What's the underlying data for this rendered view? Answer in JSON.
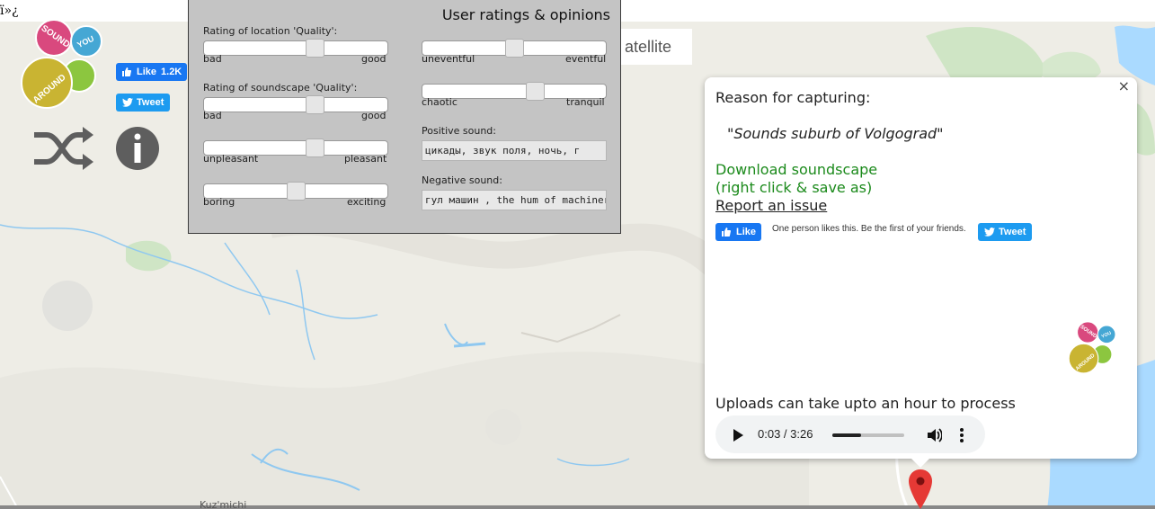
{
  "top_bar": {
    "garbled_text": "ï»¿"
  },
  "logo": {
    "words": [
      "SOUND",
      "YOU",
      "AROUND"
    ]
  },
  "social": {
    "facebook_like_label": "Like",
    "facebook_like_count": "1.2K",
    "tweet_label": "Tweet"
  },
  "map": {
    "satellite_button_label": "atellite",
    "place_label": "Kuz'michi"
  },
  "ratings_panel": {
    "title": "User ratings & opinions",
    "location_quality_label": "Rating of location 'Quality':",
    "soundscape_quality_label": "Rating of soundscape 'Quality':",
    "sliders": [
      {
        "left_label": "bad",
        "right_label": "good",
        "value": 0.62
      },
      {
        "left_label": "bad",
        "right_label": "good",
        "value": 0.62
      },
      {
        "left_label": "unpleasant",
        "right_label": "pleasant",
        "value": 0.62
      },
      {
        "left_label": "boring",
        "right_label": "exciting",
        "value": 0.5
      },
      {
        "left_label": "uneventful",
        "right_label": "eventful",
        "value": 0.5
      },
      {
        "left_label": "chaotic",
        "right_label": "tranquil",
        "value": 0.63
      }
    ],
    "positive_sound_label": "Positive sound:",
    "positive_sound_value": "цикады, звук поля, ночь, г",
    "negative_sound_label": "Negative sound:",
    "negative_sound_value": "гул машин , the hum of machinery"
  },
  "info_window": {
    "close_symbol": "×",
    "reason_label": "Reason for capturing:",
    "reason_quote": "\"Sounds suburb of Volgograd\"",
    "download_line1": "Download soundscape",
    "download_line2": "(right click & save as)",
    "report_issue": "Report an issue",
    "fb_like_label": "Like",
    "fb_social_text": "One person likes this. Be the first of your friends.",
    "tweet_label": "Tweet",
    "uploads_note": "Uploads can take upto an hour to process"
  },
  "audio": {
    "time": "0:03 / 3:26",
    "progress": 0.4
  },
  "colors": {
    "facebook_blue": "#1877f2",
    "twitter_blue": "#1d9bf0",
    "download_green": "#1b8a1b",
    "marker_red": "#e53935",
    "logo_pink": "#d9497e",
    "logo_blue": "#45a7d4",
    "logo_olive": "#c9b432",
    "logo_green": "#8cc63f"
  },
  "icons": [
    "shuffle-icon",
    "info-icon",
    "facebook-thumb-icon",
    "twitter-bird-icon",
    "play-icon",
    "volume-icon",
    "more-vert-icon",
    "map-marker-icon",
    "close-icon"
  ]
}
